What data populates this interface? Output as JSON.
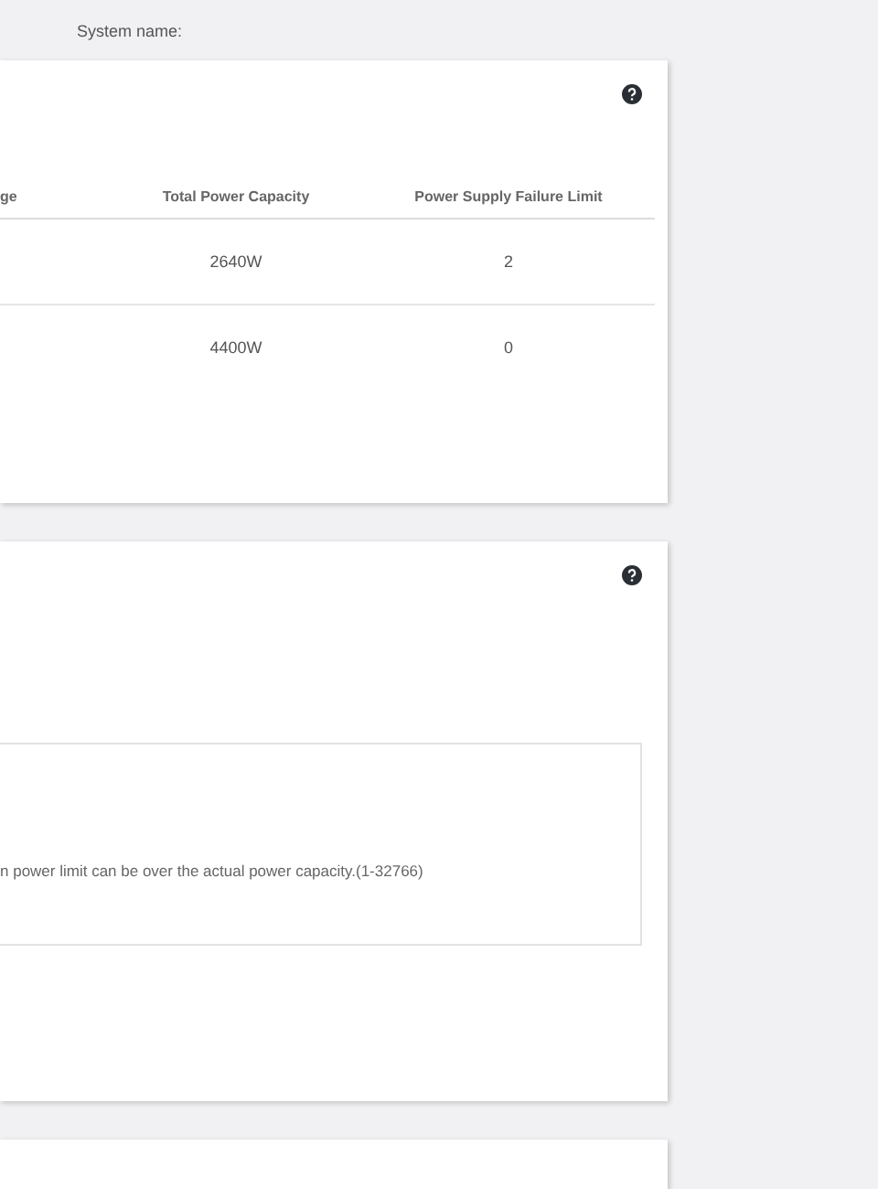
{
  "header": {
    "system_name_label": "System name:"
  },
  "power_supply_card": {
    "table": {
      "columns": [
        "ge",
        "Total Power Capacity",
        "Power Supply Failure Limit"
      ],
      "rows": [
        [
          "",
          "2640W",
          "2"
        ],
        [
          "",
          "4400W",
          "0"
        ]
      ]
    }
  },
  "power_limit_card": {
    "note": "n power limit can be over the actual power capacity.(1-32766)"
  }
}
